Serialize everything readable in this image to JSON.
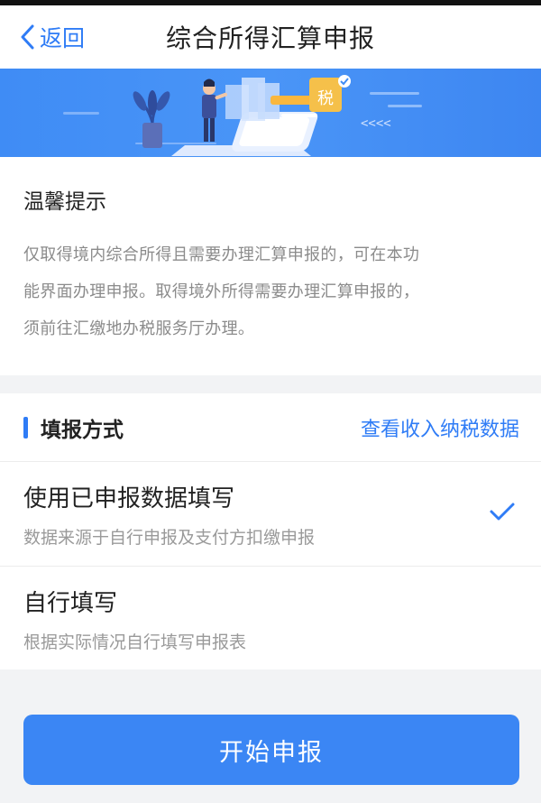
{
  "nav": {
    "back_label": "返回",
    "title": "综合所得汇算申报"
  },
  "banner": {
    "tax_badge": "税",
    "arrows": "<<<<"
  },
  "tips": {
    "title": "温馨提示",
    "lines": [
      "仅取得境内综合所得且需要办理汇算申报的，可在本功",
      "能界面办理申报。取得境外所得需要办理汇算申报的，",
      "须前往汇缴地办税服务厅办理。"
    ]
  },
  "method": {
    "title": "填报方式",
    "view_link": "查看收入纳税数据",
    "options": [
      {
        "title": "使用已申报数据填写",
        "subtitle": "数据来源于自行申报及支付方扣缴申报",
        "selected": true
      },
      {
        "title": "自行填写",
        "subtitle": "根据实际情况自行填写申报表",
        "selected": false
      }
    ]
  },
  "submit_label": "开始申报",
  "colors": {
    "accent": "#2f7cf6",
    "banner": "#4a95f7"
  }
}
